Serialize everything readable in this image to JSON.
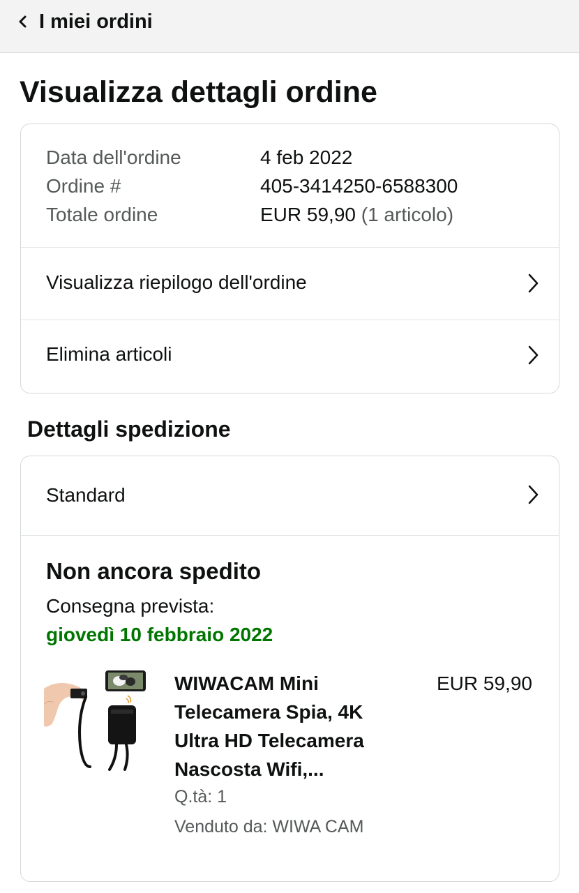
{
  "header": {
    "back_label": "I miei ordini"
  },
  "page_title": "Visualizza dettagli ordine",
  "order_info": {
    "date_label": "Data dell'ordine",
    "date_value": "4 feb 2022",
    "number_label": "Ordine #",
    "number_value": "405-3414250-6588300",
    "total_label": "Totale ordine",
    "total_value": "EUR 59,90",
    "total_items": "(1 articolo)"
  },
  "order_actions": {
    "summary_label": "Visualizza riepilogo dell'ordine",
    "delete_label": "Elimina articoli"
  },
  "shipping": {
    "section_title": "Dettagli spedizione",
    "method_label": "Standard",
    "status": "Non ancora spedito",
    "delivery_label": "Consegna prevista:",
    "delivery_date": "giovedì 10 febbraio 2022",
    "delivery_color": "#007600"
  },
  "product": {
    "title": "WIWACAM Mini Telecamera Spia, 4K Ultra HD Telecamera Nascosta Wifi,...",
    "price": "EUR 59,90",
    "quantity": "Q.tà: 1",
    "seller": "Venduto da: WIWA CAM"
  },
  "icons": {
    "back": "chevron-left-icon",
    "row_arrow": "chevron-right-icon"
  }
}
